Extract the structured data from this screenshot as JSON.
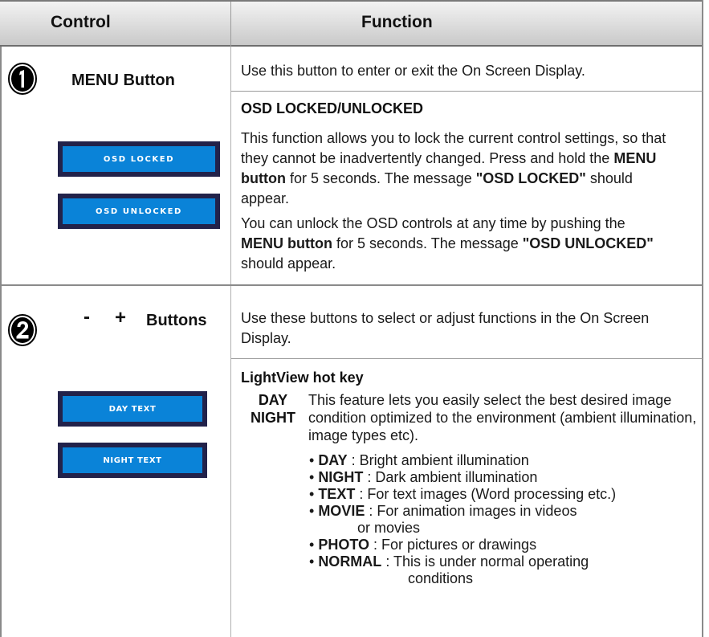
{
  "header": {
    "control": "Control",
    "function": "Function"
  },
  "section1": {
    "number_icon": "circled-number-1-icon",
    "label": "MENU Button",
    "osd_locked": "OSD LOCKED",
    "osd_unlocked": "OSD UNLOCKED",
    "intro": "Use this button to enter or exit the On Screen Display.",
    "subhead": "OSD LOCKED/UNLOCKED",
    "para1": {
      "t1": "This function allows you to lock the current control settings, so that they cannot be inadvertently changed. Press and hold the ",
      "b1": "MENU button",
      "t2": " for 5 seconds. The message ",
      "b2": "\"OSD LOCKED\"",
      "t3": " should appear."
    },
    "para2": {
      "t1": "You can unlock the OSD controls at any time by pushing the ",
      "b1": "MENU button",
      "t2": " for 5 seconds. The message ",
      "b2": "\"OSD UNLOCKED\"",
      "t3": " should appear."
    }
  },
  "section2": {
    "number_icon": "circled-number-2-icon",
    "minus": "-",
    "plus": "+",
    "label": "Buttons",
    "osd_day": "DAY TEXT",
    "osd_night": "NIGHT TEXT",
    "intro": "Use these buttons to select or adjust functions in the On Screen Display.",
    "subhead": "LightView hot key",
    "day": "DAY",
    "night": "NIGHT",
    "desc": "This feature lets you easily select the best desired image condition optimized to the environment (ambient illumination, image types etc).",
    "bullets": [
      {
        "term": "DAY",
        "text": " : Bright ambient illumination"
      },
      {
        "term": "NIGHT",
        "text": " : Dark ambient illumination"
      },
      {
        "term": "TEXT",
        "text": " : For text images (Word processing etc.)"
      },
      {
        "term": "MOVIE",
        "text": " : For animation images in videos"
      },
      {
        "cont": "or movies"
      },
      {
        "term": "PHOTO",
        "text": " : For pictures or drawings"
      },
      {
        "term": "NORMAL",
        "text": " : This is under normal operating"
      },
      {
        "cont": "conditions"
      }
    ]
  },
  "colors": {
    "osd_frame": "#22224a",
    "osd_fill": "#0a83d8",
    "header_bg": "#dcdcdc"
  }
}
